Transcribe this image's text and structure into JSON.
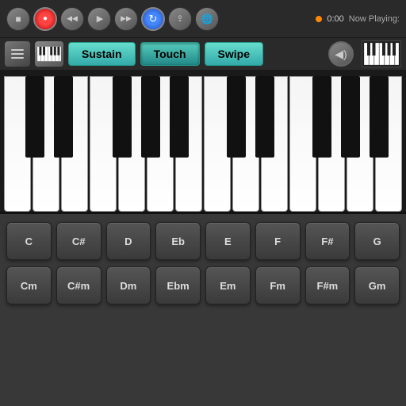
{
  "toolbar": {
    "time": "0:00",
    "now_playing_label": "Now Playing:"
  },
  "mode_toolbar": {
    "sustain_label": "Sustain",
    "touch_label": "Touch",
    "swipe_label": "Swipe"
  },
  "chords_major": {
    "headers": [
      "C",
      "C#",
      "D",
      "Eb",
      "E",
      "F",
      "F#",
      "G"
    ]
  },
  "chords_minor": {
    "headers": [
      "Cm",
      "C#m",
      "Dm",
      "Ebm",
      "Em",
      "Fm",
      "F#m",
      "Gm"
    ]
  },
  "icons": {
    "stop": "■",
    "record": "●",
    "rewind": "◀◀",
    "play": "▶",
    "forward": "▶▶",
    "refresh": "↻",
    "share": "⇪",
    "globe": "🌐",
    "volume": "🔊"
  }
}
